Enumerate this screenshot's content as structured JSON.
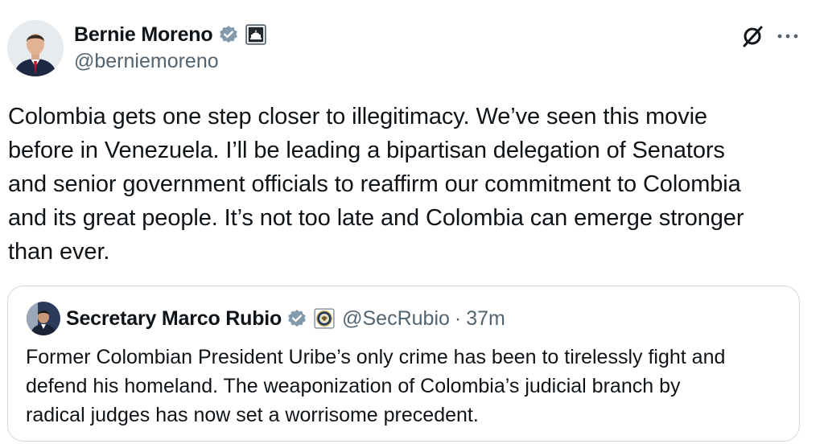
{
  "tweet": {
    "author": {
      "display_name": "Bernie Moreno",
      "handle": "@berniemoreno",
      "verified_icon": "verified-badge-icon",
      "affiliation_icon": "capitol-building-icon"
    },
    "header_actions": {
      "grok_icon": "grok-icon",
      "more_icon": "more-options-icon"
    },
    "text": "Colombia gets one step closer to illegitimacy. We’ve seen this movie\nbefore in Venezuela. I’ll be leading a bipartisan delegation of Senators\nand senior government officials to reaffirm our commitment to Colombia\nand its great people. It’s not too late and Colombia can emerge stronger\nthan ever."
  },
  "quote": {
    "display_name": "Secretary Marco Rubio",
    "handle": "@SecRubio",
    "separator": "·",
    "time": "37m",
    "verified_icon": "verified-badge-icon",
    "affiliation_icon": "state-department-seal-icon",
    "text": "Former Colombian President Uribe’s only crime has been to tirelessly fight and\ndefend his homeland. The weaponization of Colombia’s judicial branch by\nradical judges has now set a worrisome precedent."
  },
  "colors": {
    "verified_badge": "#829aab",
    "secondary_text": "#536471",
    "border": "#cfd9de"
  }
}
